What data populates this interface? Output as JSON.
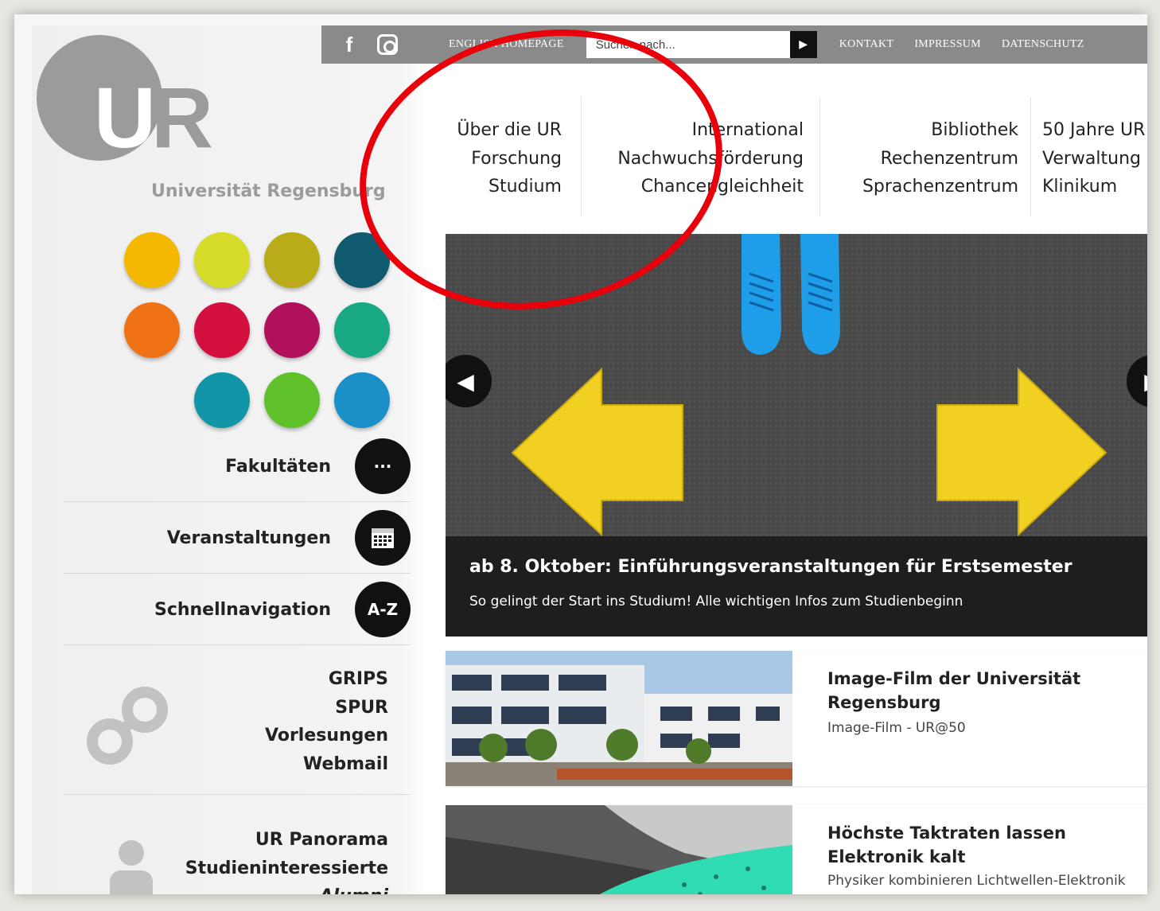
{
  "topbar": {
    "facebook_icon": "facebook-icon",
    "instagram_icon": "instagram-icon",
    "english_link": "ENGLISH HOMEPAGE",
    "search_placeholder": "Suchen nach...",
    "kontakt": "KONTAKT",
    "impressum": "IMPRESSUM",
    "datenschutz": "DATENSCHUTZ"
  },
  "logo": {
    "mark": "UR",
    "name": "Universität Regensburg"
  },
  "main_nav": {
    "col1": [
      "Über die UR",
      "Forschung",
      "Studium"
    ],
    "col2": [
      "International",
      "Nachwuchsförderung",
      "Chancengleichheit"
    ],
    "col3": [
      "Bibliothek",
      "Rechenzentrum",
      "Sprachenzentrum"
    ],
    "col4": [
      "50 Jahre UR",
      "Verwaltung",
      "Klinikum"
    ]
  },
  "faculty_dots": {
    "colors": [
      "#f5b800",
      "#d7dc2a",
      "#b9ac18",
      "#0f5a6e",
      "#f07214",
      "#d4103f",
      "#b0105c",
      "#18a882",
      "#1196a8",
      "#5fc22a",
      "#1b8fc8"
    ]
  },
  "quicklinks": [
    {
      "label": "Fakultäten",
      "icon": "···"
    },
    {
      "label": "Veranstaltungen",
      "icon": "calendar-icon"
    },
    {
      "label": "Schnellnavigation",
      "icon": "A-Z"
    }
  ],
  "links_group1": [
    "GRIPS",
    "SPUR",
    "Vorlesungen",
    "Webmail"
  ],
  "links_group2": [
    "UR Panorama",
    "Studieninteressierte",
    "Alumni"
  ],
  "slider": {
    "title": "ab 8. Oktober: Einführungsveranstaltungen für Erstsemester",
    "subtitle": "So gelingt der Start ins Studium! Alle wichtigen Infos zum Studienbeginn"
  },
  "news": [
    {
      "title": "Image-Film der Universität Regensburg",
      "text": "Image-Film - UR@50"
    },
    {
      "title": "Höchste Taktraten lassen Elektronik kalt",
      "text": "Physiker kombinieren Lichtwellen-Elektronik mit topologischen Isolatoren"
    }
  ],
  "annotation_color": "#e8000b"
}
